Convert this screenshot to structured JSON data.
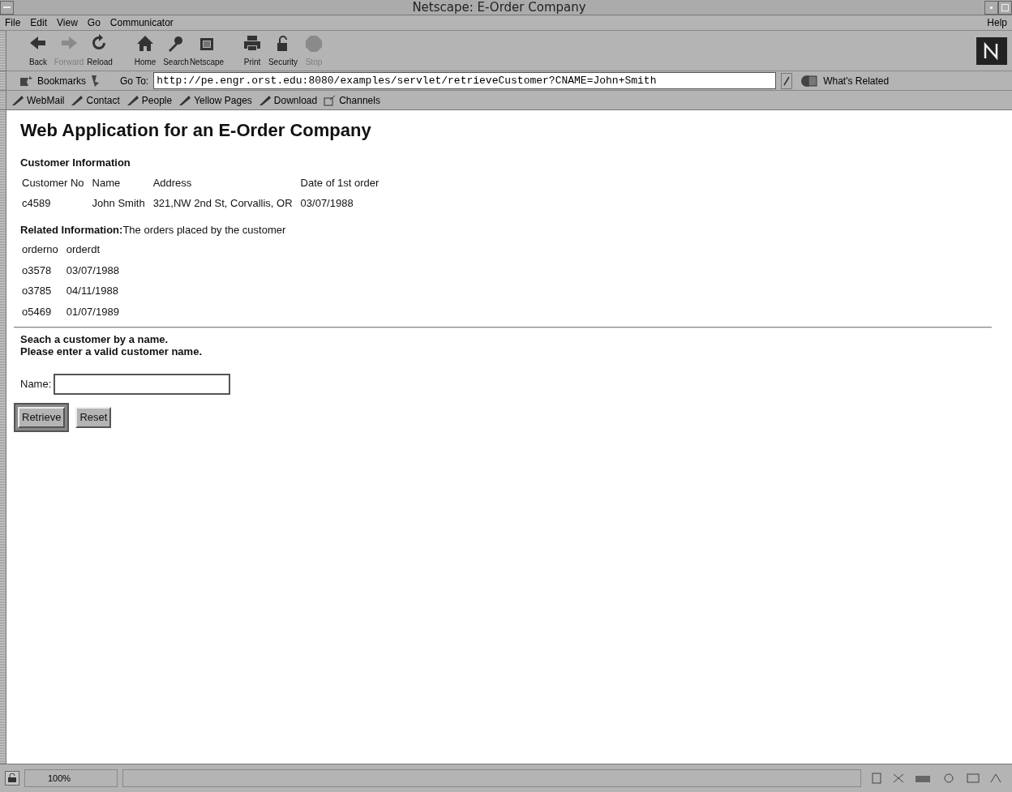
{
  "window": {
    "title": "Netscape: E-Order Company"
  },
  "menu": [
    "File",
    "Edit",
    "View",
    "Go",
    "Communicator"
  ],
  "help_menu": "Help",
  "toolbar": [
    {
      "label": "Back",
      "disabled": false
    },
    {
      "label": "Forward",
      "disabled": true
    },
    {
      "label": "Reload",
      "disabled": false
    },
    {
      "label": "Home",
      "disabled": false
    },
    {
      "label": "Search",
      "disabled": false
    },
    {
      "label": "Netscape",
      "disabled": false
    },
    {
      "label": "Print",
      "disabled": false
    },
    {
      "label": "Security",
      "disabled": false
    },
    {
      "label": "Stop",
      "disabled": true
    }
  ],
  "location_bar": {
    "bookmarks": "Bookmarks",
    "goto_label": "Go To:",
    "url": "http://pe.engr.orst.edu:8080/examples/servlet/retrieveCustomer?CNAME=John+Smith",
    "related": "What's Related"
  },
  "personal_toolbar": [
    {
      "label": "WebMail",
      "kind": "bookmark"
    },
    {
      "label": "Contact",
      "kind": "bookmark"
    },
    {
      "label": "People",
      "kind": "bookmark"
    },
    {
      "label": "Yellow Pages",
      "kind": "bookmark"
    },
    {
      "label": "Download",
      "kind": "bookmark"
    },
    {
      "label": "Channels",
      "kind": "channel"
    }
  ],
  "page": {
    "heading": "Web Application for an E-Order Company",
    "customer_section": "Customer Information",
    "customer_table": {
      "columns": [
        "Customer No",
        "Name",
        "Address",
        "Date of 1st order"
      ],
      "rows": [
        [
          "c4589",
          "John Smith",
          "321,NW 2nd St, Corvallis, OR",
          "03/07/1988"
        ]
      ]
    },
    "related_section": "**Related Information:**The orders placed by the customer",
    "orders_table": {
      "columns": [
        "orderno",
        "orderdt"
      ],
      "rows": [
        [
          "o3578",
          "03/07/1988"
        ],
        [
          "o3785",
          "04/11/1988"
        ],
        [
          "o5469",
          "01/07/1989"
        ]
      ]
    },
    "search_lines": [
      "Seach a customer by a name.",
      "Please enter a valid customer name."
    ],
    "name_label": "Name:",
    "buttons": [
      "Retrieve",
      "Reset"
    ]
  },
  "status_bar": {
    "zoom": "100%"
  }
}
